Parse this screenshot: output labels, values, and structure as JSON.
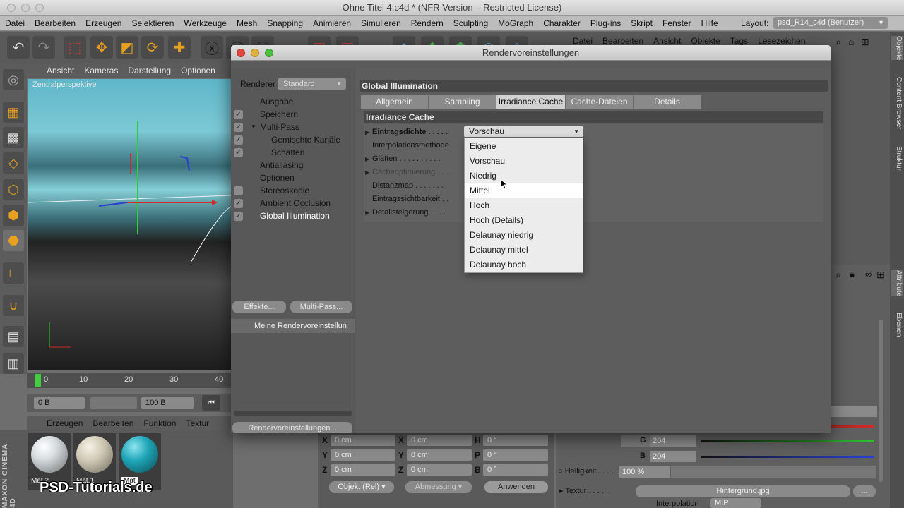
{
  "window": {
    "title": "Ohne Titel 4.c4d * (NFR Version – Restricted License)",
    "layout_label": "Layout:",
    "layout_value": "psd_R14_c4d (Benutzer)"
  },
  "menubar": [
    "Datei",
    "Bearbeiten",
    "Erzeugen",
    "Selektieren",
    "Werkzeuge",
    "Mesh",
    "Snapping",
    "Animieren",
    "Simulieren",
    "Rendern",
    "Sculpting",
    "MoGraph",
    "Charakter",
    "Plug-ins",
    "Skript",
    "Fenster",
    "Hilfe"
  ],
  "viewport": {
    "menu": [
      "Ansicht",
      "Kameras",
      "Darstellung",
      "Optionen"
    ],
    "label": "Zentralperspektive"
  },
  "timeline": {
    "ticks": [
      "0",
      "10",
      "20",
      "30",
      "40"
    ],
    "start_field": "0 B",
    "end_field": "100 B"
  },
  "material_manager": {
    "menu": [
      "Erzeugen",
      "Bearbeiten",
      "Funktion",
      "Textur"
    ],
    "materials": [
      {
        "label": "Mat.2",
        "color": "#d8dde0"
      },
      {
        "label": "Mat.1",
        "color": "#cfc8b4"
      },
      {
        "label": "Mat",
        "color": "#1fa6b8"
      }
    ]
  },
  "branding": {
    "maxon": "MAXON CINEMA 4D",
    "watermark": "PSD-Tutorials.de"
  },
  "coordinates": {
    "rows": [
      {
        "l1": "X",
        "v1": "0 cm",
        "l2": "X",
        "v2": "0 cm",
        "l3": "H",
        "v3": "0 °"
      },
      {
        "l1": "Y",
        "v1": "0 cm",
        "l2": "Y",
        "v2": "0 cm",
        "l3": "P",
        "v3": "0 °"
      },
      {
        "l1": "Z",
        "v1": "0 cm",
        "l2": "Z",
        "v2": "0 cm",
        "l3": "B",
        "v3": "0 °"
      }
    ],
    "mode_dropdown": "Objekt (Rel)",
    "size_dropdown": "Abmessung",
    "apply_button": "Anwenden"
  },
  "object_manager": {
    "menu": [
      "Datei",
      "Bearbeiten",
      "Ansicht",
      "Objekte",
      "Tags",
      "Lesezeichen"
    ]
  },
  "side_tabs": {
    "top": [
      "Objekte",
      "Content Browser",
      "Struktur"
    ],
    "bottom": [
      "Attribute",
      "Ebenen"
    ]
  },
  "attributes": {
    "g_label": "G",
    "g_value": "204",
    "b_label": "B",
    "b_value": "204",
    "brightness_label": "Helligkeit",
    "brightness_value": "100 %",
    "texture_label": "Textur",
    "texture_value": "Hintergrund.jpg",
    "texture_more": "...",
    "interpolation_label": "Interpolation",
    "interpolation_value": "MIP"
  },
  "dialog": {
    "title": "Rendervoreinstellungen",
    "renderer_label": "Renderer",
    "renderer_value": "Standard",
    "items": [
      {
        "label": "Ausgabe",
        "checkbox": "none",
        "indent": 0,
        "selected": false
      },
      {
        "label": "Speichern",
        "checkbox": "checked",
        "indent": 0,
        "selected": false
      },
      {
        "label": "Multi-Pass",
        "checkbox": "checked",
        "indent": 0,
        "expand": true,
        "selected": false
      },
      {
        "label": "Gemischte Kanäle",
        "checkbox": "checked",
        "indent": 1,
        "selected": false
      },
      {
        "label": "Schatten",
        "checkbox": "checked",
        "indent": 1,
        "selected": false
      },
      {
        "label": "Antialiasing",
        "checkbox": "none",
        "indent": 0,
        "selected": false
      },
      {
        "label": "Optionen",
        "checkbox": "none",
        "indent": 0,
        "selected": false
      },
      {
        "label": "Stereoskopie",
        "checkbox": "unchecked",
        "indent": 0,
        "selected": false
      },
      {
        "label": "Ambient Occlusion",
        "checkbox": "checked",
        "indent": 0,
        "selected": false
      },
      {
        "label": "Global Illumination",
        "checkbox": "checked",
        "indent": 0,
        "selected": true
      }
    ],
    "effects_button": "Effekte...",
    "multipass_button": "Multi-Pass...",
    "preset_name": "Meine Rendervoreinstellun",
    "render_settings_button": "Rendervoreinstellungen...",
    "section_title": "Global Illumination",
    "tabs": [
      {
        "label": "Allgemein",
        "active": false
      },
      {
        "label": "Sampling",
        "active": false
      },
      {
        "label": "Irradiance Cache",
        "active": true
      },
      {
        "label": "Cache-Dateien",
        "active": false
      },
      {
        "label": "Details",
        "active": false
      }
    ],
    "group_title": "Irradiance Cache",
    "params": [
      {
        "label": "Eintragsdichte . . . . .",
        "arrow": true,
        "bold": true,
        "disabled": false
      },
      {
        "label": "Interpolationsmethode",
        "arrow": false,
        "bold": false,
        "disabled": false
      },
      {
        "label": "Glätten . . . . . . . . . .",
        "arrow": true,
        "bold": false,
        "disabled": false
      },
      {
        "label": "Cacheoptimierung . . . .",
        "arrow": true,
        "bold": false,
        "disabled": true
      },
      {
        "label": "Distanzmap . . . . . . .",
        "arrow": false,
        "bold": false,
        "disabled": false
      },
      {
        "label": "Eintragssichtbarkeit . .",
        "arrow": false,
        "bold": false,
        "disabled": false
      },
      {
        "label": "Detailsteigerung . . . .",
        "arrow": true,
        "bold": false,
        "disabled": false
      }
    ],
    "density_value": "Vorschau",
    "density_options": [
      "Eigene",
      "Vorschau",
      "Niedrig",
      "Mittel",
      "Hoch",
      "Hoch (Details)",
      "Delaunay niedrig",
      "Delaunay mittel",
      "Delaunay hoch"
    ],
    "hovered_option": "Mittel"
  },
  "colors": {
    "accent_orange": "#e8a020",
    "red_slider": "#d42a2a",
    "green_slider": "#2fc42f",
    "blue_slider": "#2a3fd4"
  }
}
